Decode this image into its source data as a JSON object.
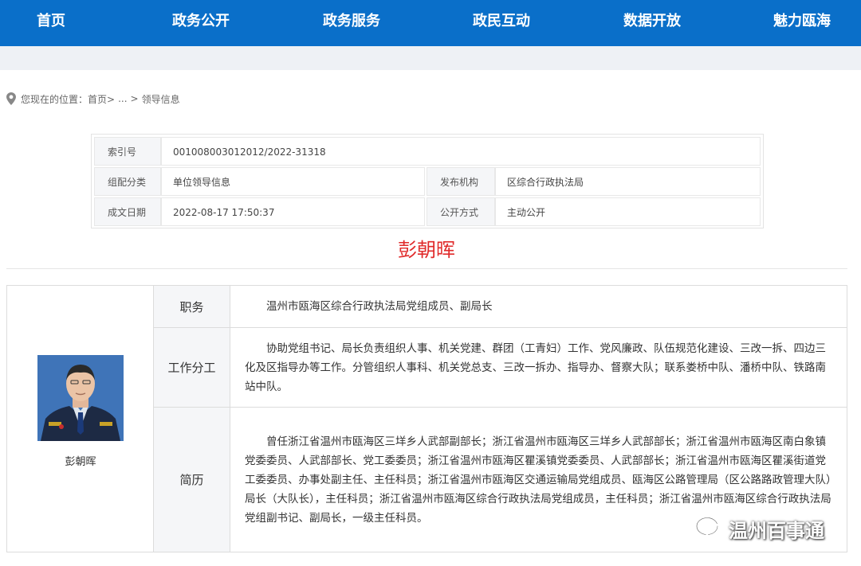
{
  "nav": {
    "items": [
      "首页",
      "政务公开",
      "政务服务",
      "政民互动",
      "数据开放",
      "魅力瓯海"
    ]
  },
  "breadcrumb": {
    "prefix": "您现在的位置：",
    "home": "首页>",
    "ellipsis": "...",
    "separator": ">",
    "current": "领导信息"
  },
  "meta": {
    "index_label": "索引号",
    "index_value": "001008003012012/2022-31318",
    "category_label": "组配分类",
    "category_value": "单位领导信息",
    "issuer_label": "发布机构",
    "issuer_value": "区综合行政执法局",
    "date_label": "成文日期",
    "date_value": "2022-08-17 17:50:37",
    "disclosure_label": "公开方式",
    "disclosure_value": "主动公开"
  },
  "person": {
    "name": "彭朝晖",
    "caption": "彭朝晖",
    "position_label": "职务",
    "position_value": "温州市瓯海区综合行政执法局党组成员、副局长",
    "duty_label": "工作分工",
    "duty_value": "协助党组书记、局长负责组织人事、机关党建、群团（工青妇）工作、党风廉政、队伍规范化建设、三改一拆、四边三化及区指导办等工作。分管组织人事科、机关党总支、三改一拆办、指导办、督察大队；联系娄桥中队、潘桥中队、铁路南站中队。",
    "resume_label": "简历",
    "resume_value": "曾任浙江省温州市瓯海区三垟乡人武部副部长；浙江省温州市瓯海区三垟乡人武部部长；浙江省温州市瓯海区南白象镇党委委员、人武部部长、党工委委员；浙江省温州市瓯海区瞿溪镇党委委员、人武部部长；浙江省温州市瓯海区瞿溪街道党工委委员、办事处副主任、主任科员；浙江省温州市瓯海区交通运输局党组成员、瓯海区公路管理局（区公路路政管理大队）局长（大队长），主任科员；浙江省温州市瓯海区综合行政执法局党组成员，主任科员；浙江省温州市瓯海区综合行政执法局党组副书记、副局长，一级主任科员。"
  },
  "watermark": {
    "text": "温州百事通"
  },
  "colors": {
    "nav_bg": "#0a6fc9",
    "title_red": "#e02a2a"
  }
}
